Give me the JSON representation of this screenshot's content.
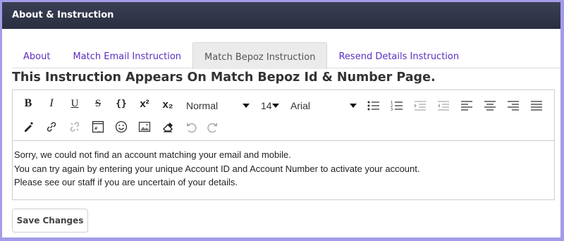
{
  "header": {
    "title": "About & Instruction"
  },
  "tabs": [
    {
      "label": "About"
    },
    {
      "label": "Match Email Instruction"
    },
    {
      "label": "Match Bepoz Instruction",
      "active": true
    },
    {
      "label": "Resend Details Instruction"
    }
  ],
  "section_title": "This Instruction Appears On Match Bepoz Id & Number Page.",
  "toolbar": {
    "block_format": "Normal",
    "font_size": "14",
    "font_family": "Arial",
    "bold_glyph": "B",
    "italic_glyph": "I",
    "underline_glyph": "U",
    "strike_glyph": "S",
    "code_glyph": "{}",
    "superscript_glyph": "x²",
    "subscript_glyph": "x₂"
  },
  "editor": {
    "lines": [
      "Sorry, we could not find an account matching your email and mobile.",
      "You can try again by entering your unique Account ID and Account Number to activate your account.",
      "Please see our staff if you are uncertain of your details."
    ]
  },
  "save_button": "Save Changes",
  "colors": {
    "header_bg": "#2e3246",
    "tab_link": "#5b2fc0",
    "frame_border": "#a49ce8"
  }
}
